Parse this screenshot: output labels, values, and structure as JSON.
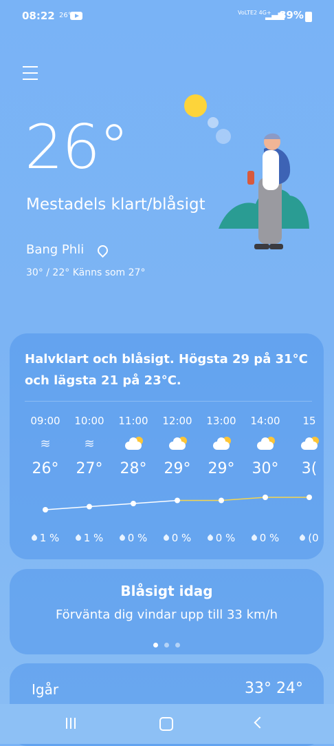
{
  "status_bar": {
    "time": "08:22",
    "mini_temp": "26°",
    "network": "VoLTE2 4G+",
    "battery": "89%"
  },
  "current": {
    "temperature": "26°",
    "condition": "Mestadels klart/blåsigt",
    "location": "Bang Phli",
    "range": "30° / 22° Känns som 27°"
  },
  "forecast_card": {
    "summary": "Halvklart och blåsigt. Högsta 29 på 31°C och lägsta 21 på 23°C.",
    "hours": [
      {
        "time": "09:00",
        "icon": "wind-icon",
        "temp": "26°",
        "rain": "1 %"
      },
      {
        "time": "10:00",
        "icon": "wind-icon",
        "temp": "27°",
        "rain": "1 %"
      },
      {
        "time": "11:00",
        "icon": "partly-cloudy-icon",
        "temp": "28°",
        "rain": "0 %"
      },
      {
        "time": "12:00",
        "icon": "partly-cloudy-icon",
        "temp": "29°",
        "rain": "0 %"
      },
      {
        "time": "13:00",
        "icon": "partly-cloudy-icon",
        "temp": "29°",
        "rain": "0 %"
      },
      {
        "time": "14:00",
        "icon": "partly-cloudy-icon",
        "temp": "30°",
        "rain": "0 %"
      },
      {
        "time": "15",
        "icon": "partly-cloudy-icon",
        "temp": "3(",
        "rain": "(0"
      }
    ],
    "temp_values": [
      26,
      27,
      28,
      29,
      29,
      30,
      30
    ]
  },
  "alert_card": {
    "title": "Blåsigt idag",
    "subtitle": "Förvänta dig vindar upp till 33 km/h"
  },
  "yesterday": {
    "label": "Igår",
    "temps": "33° 24°"
  },
  "colors": {
    "accent_line": "#f7d54c",
    "sun": "#fdd43a"
  }
}
